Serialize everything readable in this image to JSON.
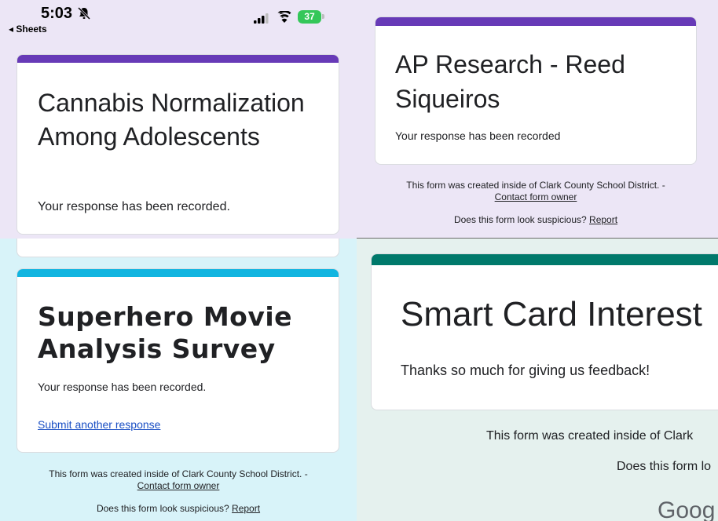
{
  "status_bar": {
    "time": "5:03",
    "back_label": "◂ Sheets",
    "battery": "37"
  },
  "panels": {
    "cannabis": {
      "title": "Cannabis Normalization Among Adolescents",
      "message": "Your response has been recorded.",
      "accent_color": "#673ab7"
    },
    "ap_research": {
      "title": "AP Research - Reed Siqueiros",
      "message": "Your response has been recorded",
      "accent_color": "#673ab7",
      "footer_line1": "This form was created inside of Clark County School District. -",
      "contact_link": "Contact form owner",
      "suspicious_text": "Does this form look suspicious?",
      "report_link": "Report"
    },
    "superhero": {
      "title": "Superhero Movie Analysis Survey",
      "message": "Your response has been recorded.",
      "submit_another": "Submit another response",
      "accent_color": "#12b5e0",
      "footer_line1": "This form was created inside of Clark County School District. -",
      "contact_link": "Contact form owner",
      "suspicious_text": "Does this form look suspicious?",
      "report_link": "Report"
    },
    "smart_card": {
      "title": "Smart Card Interest",
      "message": "Thanks so much for giving us feedback!",
      "accent_color": "#00796b",
      "footer_line1": "This form was created inside of Clark",
      "suspicious_text": "Does this form lo",
      "brand": "Goog"
    }
  }
}
